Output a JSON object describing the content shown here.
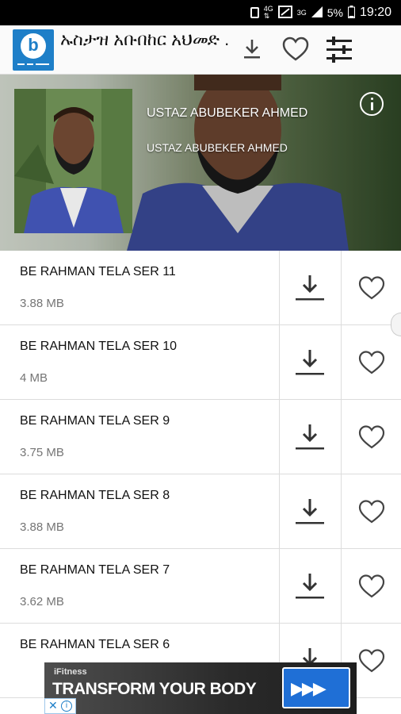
{
  "status_bar": {
    "time": "19:20",
    "battery": "5%",
    "network": "3G",
    "icons": [
      "sim-icon",
      "network-4g-icon",
      "signal-icon",
      "battery-icon"
    ]
  },
  "app_bar": {
    "title": "ኡስታዝ አቡበከር አህመድ .",
    "logo_letter": "b",
    "icons": [
      "download-icon",
      "heart-icon",
      "filter-icon"
    ]
  },
  "header": {
    "artist_name": "USTAZ ABUBEKER AHMED",
    "artist_subtitle": "USTAZ ABUBEKER AHMED",
    "info_icon": "info-icon"
  },
  "tracks": [
    {
      "title": "BE RAHMAN TELA SER 11",
      "size": "3.88 MB"
    },
    {
      "title": "BE RAHMAN TELA SER 10",
      "size": "4 MB"
    },
    {
      "title": "BE RAHMAN TELA SER 9",
      "size": "3.75 MB"
    },
    {
      "title": "BE RAHMAN TELA SER 8",
      "size": "3.88 MB"
    },
    {
      "title": "BE RAHMAN TELA SER 7",
      "size": "3.62 MB"
    },
    {
      "title": "BE RAHMAN TELA SER 6",
      "size": ""
    }
  ],
  "ad": {
    "brand": "iFitness",
    "headline": "TRANSFORM YOUR BODY",
    "cta_symbol": "▶▶▶",
    "close_symbol": "✕",
    "info_symbol": "i"
  },
  "colors": {
    "logo": "#1e7fc8",
    "ad_cta": "#1f6fd6",
    "text_primary": "#111111",
    "text_secondary": "#757575"
  }
}
